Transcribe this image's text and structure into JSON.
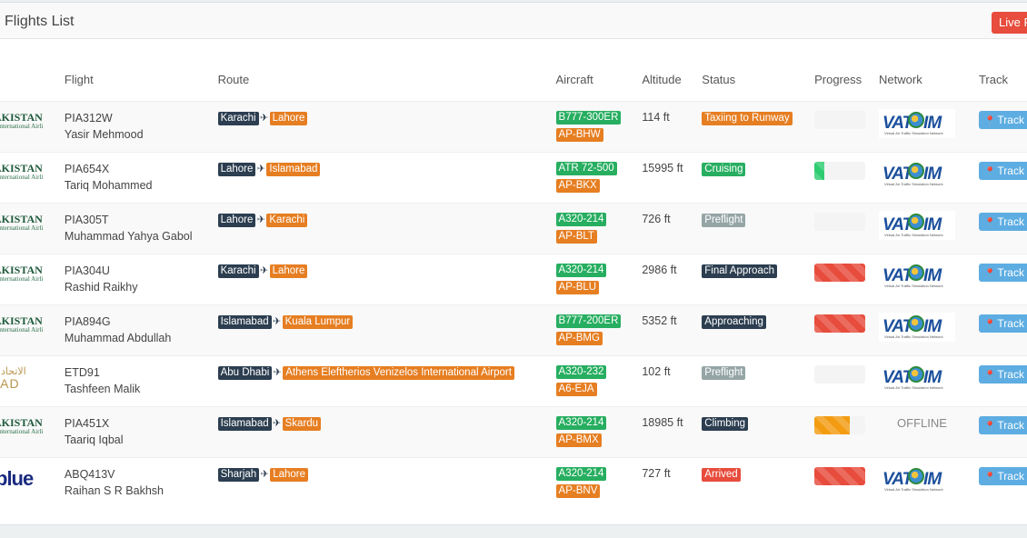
{
  "panel": {
    "title": "Flights List",
    "live_button": "Live F"
  },
  "columns": [
    "",
    "Flight",
    "Route",
    "Aircraft",
    "Altitude",
    "Status",
    "Progress",
    "Network",
    "Track"
  ],
  "rows": [
    {
      "airline": "pia",
      "airline_text": "AKISTAN",
      "airline_sub": "International Airlines",
      "flight": "PIA312W",
      "pilot": "Yasir Mehmood",
      "from": "Karachi",
      "to": "Lahore",
      "aircraft": "B777-300ER",
      "reg": "AP-BHW",
      "altitude": "114 ft",
      "status": "Taxiing to Runway",
      "status_color": "#e67e22",
      "progress": 0,
      "progress_color": "#f4f4f4",
      "network": "VATSIM",
      "track": "Track F"
    },
    {
      "airline": "pia",
      "airline_text": "AKISTAN",
      "airline_sub": "International Airlines",
      "flight": "PIA654X",
      "pilot": "Tariq Mohammed",
      "from": "Lahore",
      "to": "Islamabad",
      "aircraft": "ATR 72-500",
      "reg": "AP-BKX",
      "altitude": "15995 ft",
      "status": "Cruising",
      "status_color": "#27ae60",
      "progress": 0.2,
      "progress_color": "#2ecc71",
      "network": "VATSIM",
      "track": "Track F"
    },
    {
      "airline": "pia",
      "airline_text": "AKISTAN",
      "airline_sub": "International Airlines",
      "flight": "PIA305T",
      "pilot": "Muhammad Yahya Gabol",
      "from": "Lahore",
      "to": "Karachi",
      "aircraft": "A320-214",
      "reg": "AP-BLT",
      "altitude": "726 ft",
      "status": "Preflight",
      "status_color": "#95a5a6",
      "progress": 0,
      "progress_color": "#f4f4f4",
      "network": "VATSIM",
      "track": "Track F"
    },
    {
      "airline": "pia",
      "airline_text": "AKISTAN",
      "airline_sub": "International Airlines",
      "flight": "PIA304U",
      "pilot": "Rashid Raikhy",
      "from": "Karachi",
      "to": "Lahore",
      "aircraft": "A320-214",
      "reg": "AP-BLU",
      "altitude": "2986 ft",
      "status": "Final Approach",
      "status_color": "#2c3e50",
      "progress": 1,
      "progress_color": "#e74c3c",
      "network": "VATSIM",
      "track": "Track F"
    },
    {
      "airline": "pia",
      "airline_text": "AKISTAN",
      "airline_sub": "International Airlines",
      "flight": "PIA894G",
      "pilot": "Muhammad Abdullah",
      "from": "Islamabad",
      "to": "Kuala Lumpur",
      "aircraft": "B777-200ER",
      "reg": "AP-BMG",
      "altitude": "5352 ft",
      "status": "Approaching",
      "status_color": "#2c3e50",
      "progress": 1,
      "progress_color": "#e74c3c",
      "network": "VATSIM",
      "track": "Track F"
    },
    {
      "airline": "etd",
      "airline_text": "الاتحاد",
      "airline_sub": "HAD",
      "flight": "ETD91",
      "pilot": "Tashfeen Malik",
      "from": "Abu Dhabi",
      "to": "Athens Eleftherios Venizelos International Airport",
      "aircraft": "A320-232",
      "reg": "A6-EJA",
      "altitude": "102 ft",
      "status": "Preflight",
      "status_color": "#95a5a6",
      "progress": 0,
      "progress_color": "#f4f4f4",
      "network": "VATSIM",
      "track": "Track F"
    },
    {
      "airline": "pia",
      "airline_text": "AKISTAN",
      "airline_sub": "International Airlines",
      "flight": "PIA451X",
      "pilot": "Taariq Iqbal",
      "from": "Islamabad",
      "to": "Skardu",
      "aircraft": "A320-214",
      "reg": "AP-BMX",
      "altitude": "18985 ft",
      "status": "Climbing",
      "status_color": "#2c3e50",
      "progress": 0.7,
      "progress_color": "#f39c12",
      "network": "OFFLINE",
      "track": "Track F"
    },
    {
      "airline": "blue",
      "airline_text": "blue",
      "airline_sub": "",
      "flight": "ABQ413V",
      "pilot": "Raihan S R Bakhsh",
      "from": "Sharjah",
      "to": "Lahore",
      "aircraft": "A320-214",
      "reg": "AP-BNV",
      "altitude": "727 ft",
      "status": "Arrived",
      "status_color": "#e74c3c",
      "progress": 1,
      "progress_color": "#e74c3c",
      "network": "VATSIM",
      "track": "Track F"
    }
  ],
  "colors": {
    "dark_label": "#2c3e50",
    "orange_label": "#e67e22",
    "green_label": "#27ae60",
    "track_button": "#5dade2",
    "live_button": "#e74c3c"
  },
  "icons": {
    "route_separator": "plane-icon",
    "track": "map-marker-icon",
    "network": "vatsim-logo"
  }
}
